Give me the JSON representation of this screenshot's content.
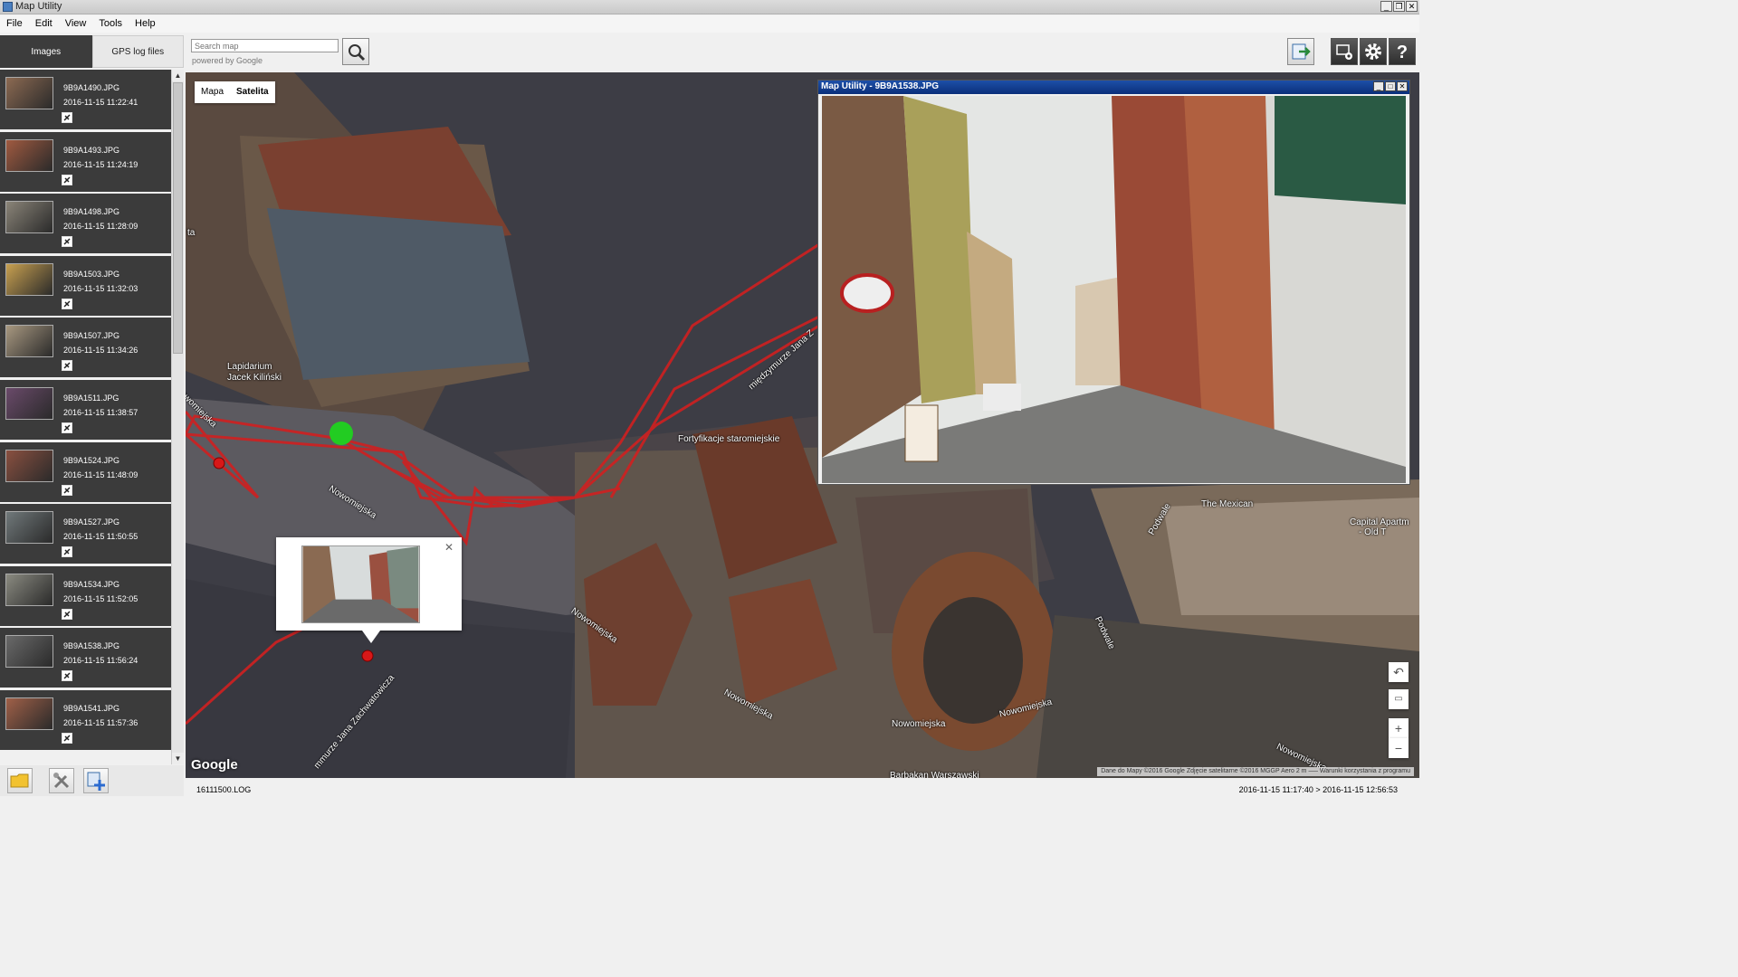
{
  "window": {
    "title": "Map Utility"
  },
  "menu": [
    "File",
    "Edit",
    "View",
    "Tools",
    "Help"
  ],
  "tabs": {
    "images": "Images",
    "gps": "GPS log files"
  },
  "search": {
    "placeholder": "Search map",
    "powered_by": "powered by Google"
  },
  "images": [
    {
      "name": "9B9A1490.JPG",
      "time": "2016-11-15 11:22:41",
      "color": "#8c6a52"
    },
    {
      "name": "9B9A1493.JPG",
      "time": "2016-11-15 11:24:19",
      "color": "#a05a40"
    },
    {
      "name": "9B9A1498.JPG",
      "time": "2016-11-15 11:28:09",
      "color": "#8a8478"
    },
    {
      "name": "9B9A1503.JPG",
      "time": "2016-11-15 11:32:03",
      "color": "#c8a050"
    },
    {
      "name": "9B9A1507.JPG",
      "time": "2016-11-15 11:34:26",
      "color": "#a89880"
    },
    {
      "name": "9B9A1511.JPG",
      "time": "2016-11-15 11:38:57",
      "color": "#6a4a6a"
    },
    {
      "name": "9B9A1524.JPG",
      "time": "2016-11-15 11:48:09",
      "color": "#8a5040"
    },
    {
      "name": "9B9A1527.JPG",
      "time": "2016-11-15 11:50:55",
      "color": "#70787a"
    },
    {
      "name": "9B9A1534.JPG",
      "time": "2016-11-15 11:52:05",
      "color": "#8a8a80"
    },
    {
      "name": "9B9A1538.JPG",
      "time": "2016-11-15 11:56:24",
      "color": "#6a6a6a"
    },
    {
      "name": "9B9A1541.JPG",
      "time": "2016-11-15 11:57:36",
      "color": "#a06048"
    }
  ],
  "map": {
    "type_map": "Mapa",
    "type_satellite": "Satelita",
    "labels": {
      "lapidarium_1": "Lapidarium",
      "lapidarium_2": "Jacek Kiliński",
      "nowomiejska_1": "Nowomiejska",
      "nowomiejska_2": "Nowomiejska",
      "nowomiejska_3": "Nowomiejska",
      "nowomiejska_4": "Nowomiejska",
      "nowomiejska_5": "Nowomiejska",
      "nowomiejska_6": "Nowomiejska",
      "nowomiejska_7": "Nowomiejska",
      "miedzymurze": "międzymurze Jana Z",
      "fortyfikacje": "Fortyfikacje staromiejskie",
      "mexican": "The Mexican",
      "capital_1": "Capital Apartm",
      "capital_2": "- Old T",
      "podwale_1": "Podwale",
      "podwale_2": "Podwale",
      "zachwatowicza": "mmurze Jana Zachwatowicza",
      "barbakan": "Barbakan Warszawski",
      "ta": "ta"
    },
    "google": "Google",
    "attribution": "Dane do Mapy ©2016 Google Zdjęcie satelitarne ©2016 MGGP Aero   2 m ⎯⎯⎯   Warunki korzystania z programu",
    "zoom_in": "+",
    "zoom_out": "−"
  },
  "viewer": {
    "title": "Map Utility - 9B9A1538.JPG"
  },
  "status": {
    "log": "16111500.LOG",
    "range": "2016-11-15 11:17:40 > 2016-11-15 12:56:53"
  },
  "colors": {
    "track": "#d02020",
    "marker": "#d81818",
    "current": "#22cc22",
    "sidebar_bg": "#3b3b3b"
  }
}
